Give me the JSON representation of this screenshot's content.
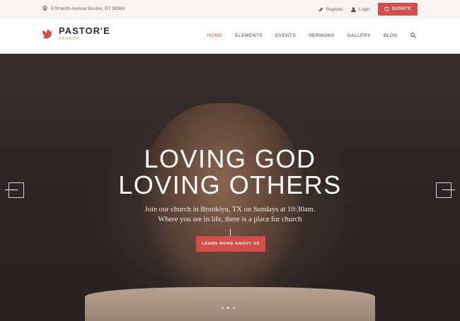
{
  "topbar": {
    "address": "578 tenth Avenue Boston, BT 58966",
    "register": "Register",
    "login": "Login",
    "donate": "DONATE"
  },
  "brand": {
    "name": "PASTOR'E",
    "tagline": "CHURCH",
    "accent": "#d54d4a"
  },
  "nav": {
    "items": [
      "HOME",
      "ELEMENTS",
      "EVENTS",
      "SERMONS",
      "GALLERY",
      "BLOG"
    ],
    "active_index": 0
  },
  "hero": {
    "headline_1": "LOVING GOD",
    "headline_2": "LOVING OTHERS",
    "subtitle_1": "Join our church in Brooklyn, TX on Sundays at 10:30am.",
    "subtitle_2": "Where you are in life, there is a place for church",
    "cta": "LEARN MORE ABOUT US",
    "slides": 3,
    "active_slide": 1
  },
  "icons": {
    "address": "map-pin-icon",
    "register": "pencil-icon",
    "login": "user-icon",
    "donate": "heart-icon",
    "logo": "dove-icon",
    "search": "search-icon"
  }
}
